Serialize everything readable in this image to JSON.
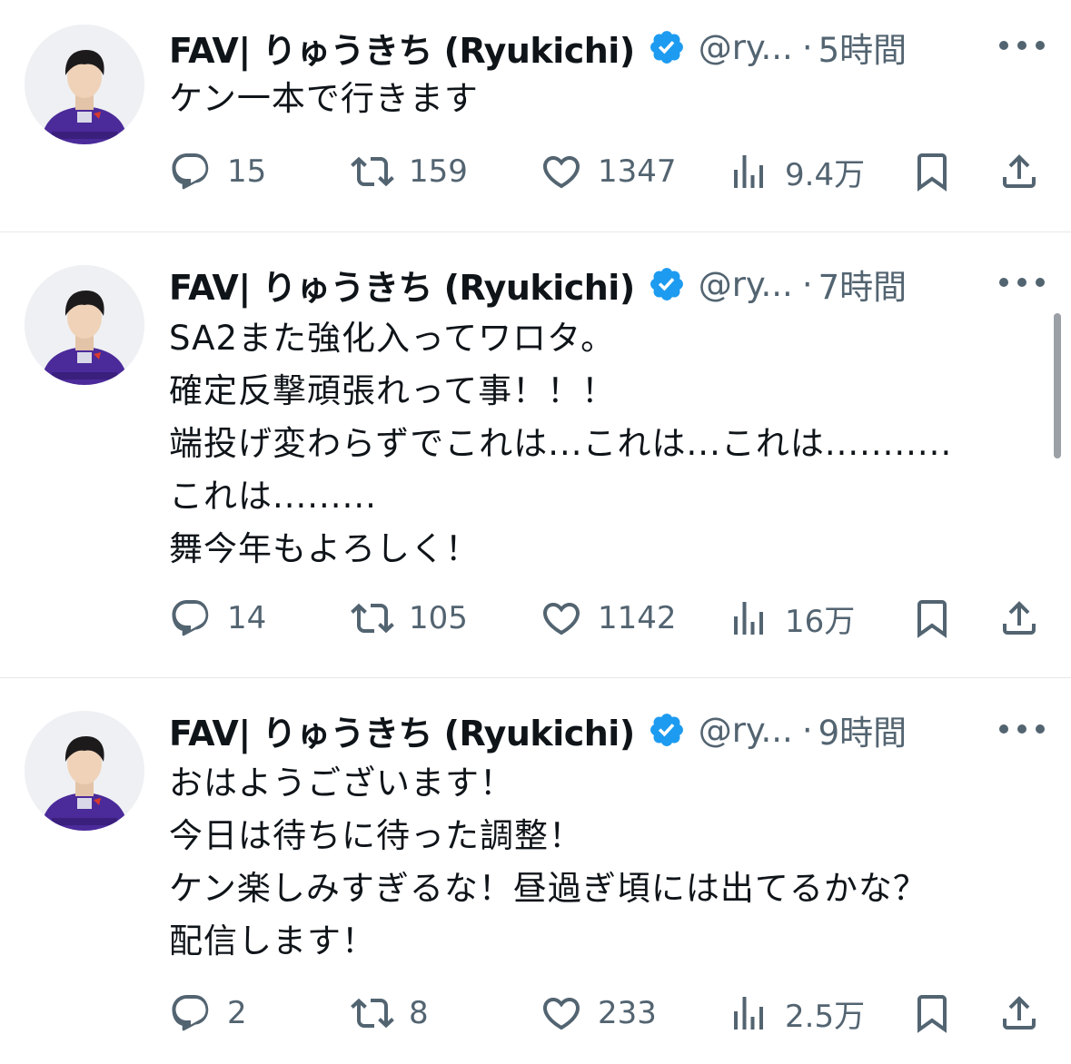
{
  "colors": {
    "text": "#0f1419",
    "muted": "#536471",
    "verified": "#1d9bf0",
    "divider": "#e6e8eb"
  },
  "icons": {
    "reply": "speech-bubble-icon",
    "retweet": "retweet-arrows-icon",
    "like": "heart-icon",
    "views": "bar-chart-icon",
    "bookmark": "bookmark-icon",
    "share": "share-upload-icon",
    "more": "three-dots-icon",
    "verified": "verified-badge-icon"
  },
  "tweets": [
    {
      "name": "FAV| りゅうきち (Ryukichi)",
      "handle": "@ry...",
      "separator": "·",
      "time": "5時間",
      "lines": [
        "ケン一本で行きます"
      ],
      "replies": "15",
      "retweets": "159",
      "likes": "1347",
      "views": "9.4万"
    },
    {
      "name": "FAV| りゅうきち (Ryukichi)",
      "handle": "@ry...",
      "separator": "·",
      "time": "7時間",
      "lines": [
        "SA2また強化入ってワロタ。",
        "確定反撃頑張れって事！！！",
        "端投げ変わらずでこれは...これは...これは...........",
        "これは.........",
        "舞今年もよろしく！"
      ],
      "replies": "14",
      "retweets": "105",
      "likes": "1142",
      "views": "16万"
    },
    {
      "name": "FAV| りゅうきち (Ryukichi)",
      "handle": "@ry...",
      "separator": "·",
      "time": "9時間",
      "lines": [
        "おはようございます！",
        "今日は待ちに待った調整！",
        "ケン楽しみすぎるな！昼過ぎ頃には出てるかな？",
        "配信します！"
      ],
      "replies": "2",
      "retweets": "8",
      "likes": "233",
      "views": "2.5万"
    }
  ]
}
